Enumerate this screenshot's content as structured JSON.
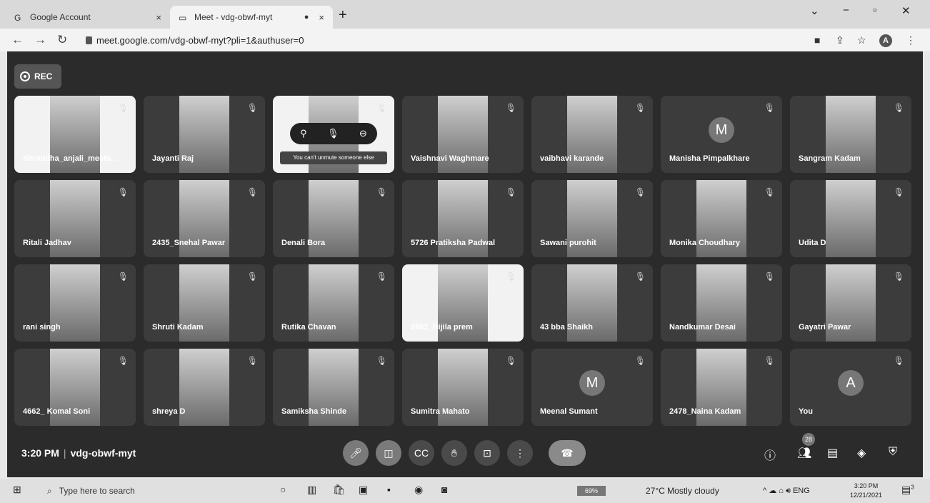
{
  "browser": {
    "tabs": [
      {
        "title": "Google Account",
        "close": "×"
      },
      {
        "title": "Meet - vdg-obwf-myt",
        "close": "×"
      }
    ],
    "new_tab": "+",
    "url": "meet.google.com/vdg-obwf-myt?pli=1&authuser=0",
    "account_initial": "A"
  },
  "meet": {
    "rec_label": "REC",
    "time": "3:20 PM",
    "meeting_code": "vdg-obwf-myt",
    "participant_count": "28",
    "pinned_tooltip": "You can't unmute someone else",
    "participants": [
      {
        "name": "Shraddha_anjali_meshi...",
        "avatar": "",
        "light": true
      },
      {
        "name": "Jayanti Raj",
        "avatar": ""
      },
      {
        "name": "",
        "avatar": "",
        "light": true,
        "overlay": true
      },
      {
        "name": "Vaishnavi Waghmare",
        "avatar": ""
      },
      {
        "name": "vaibhavi karande",
        "avatar": ""
      },
      {
        "name": "Manisha Pimpalkhare",
        "avatar": "M"
      },
      {
        "name": "Sangram Kadam",
        "avatar": ""
      },
      {
        "name": "Ritali Jadhav",
        "avatar": ""
      },
      {
        "name": "2435_Snehal Pawar",
        "avatar": ""
      },
      {
        "name": "Denali Bora",
        "avatar": ""
      },
      {
        "name": "5726 Pratiksha Padwal",
        "avatar": ""
      },
      {
        "name": "Sawani purohit",
        "avatar": ""
      },
      {
        "name": "Monika Choudhary",
        "avatar": ""
      },
      {
        "name": "Udita D",
        "avatar": ""
      },
      {
        "name": "rani singh",
        "avatar": ""
      },
      {
        "name": "Shruti Kadam",
        "avatar": ""
      },
      {
        "name": "Rutika Chavan",
        "avatar": ""
      },
      {
        "name": "2862_Nijila prem",
        "avatar": "",
        "light": true
      },
      {
        "name": "43 bba Shaikh",
        "avatar": ""
      },
      {
        "name": "Nandkumar Desai",
        "avatar": ""
      },
      {
        "name": "Gayatri Pawar",
        "avatar": ""
      },
      {
        "name": "4662_ Komal Soni",
        "avatar": ""
      },
      {
        "name": "shreya D",
        "avatar": ""
      },
      {
        "name": "Samiksha Shinde",
        "avatar": ""
      },
      {
        "name": "Sumitra Mahato",
        "avatar": ""
      },
      {
        "name": "Meenal Sumant",
        "avatar": "M"
      },
      {
        "name": "2478_Naina Kadam",
        "avatar": ""
      },
      {
        "name": "You",
        "avatar": "A"
      }
    ]
  },
  "taskbar": {
    "search_placeholder": "Type here to search",
    "battery": "69%",
    "weather": "27°C  Mostly cloudy",
    "lang": "ENG",
    "time": "3:20 PM",
    "date": "12/21/2021",
    "notif_count": "3"
  }
}
